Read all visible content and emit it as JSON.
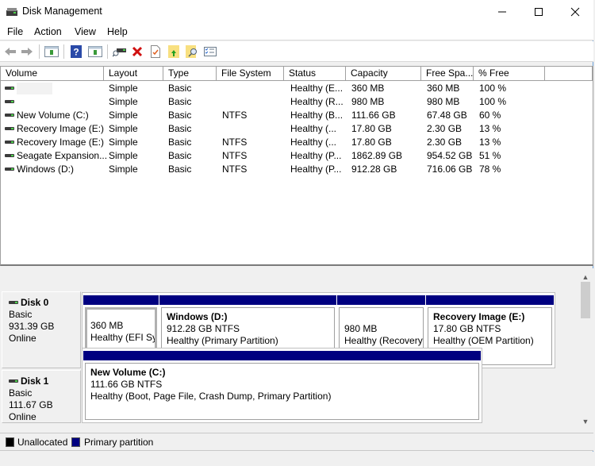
{
  "window": {
    "title": "Disk Management",
    "controls": {
      "minimize": "minimize",
      "maximize": "maximize",
      "close": "close"
    }
  },
  "menu": [
    "File",
    "Action",
    "View",
    "Help"
  ],
  "toolbar": {
    "buttons": [
      "back",
      "forward",
      "show-hide-console-tree",
      "help",
      "show-hide-action-pane",
      "connect-virtual-disk",
      "delete",
      "properties",
      "open",
      "explore",
      "settings"
    ]
  },
  "volume_list": {
    "columns": [
      "Volume",
      "Layout",
      "Type",
      "File System",
      "Status",
      "Capacity",
      "Free Spa...",
      "% Free"
    ],
    "rows": [
      {
        "volume": "",
        "layout": "Simple",
        "type": "Basic",
        "fs": "",
        "status": "Healthy (E...",
        "capacity": "360 MB",
        "free": "360 MB",
        "pct": "100 %"
      },
      {
        "volume": "",
        "layout": "Simple",
        "type": "Basic",
        "fs": "",
        "status": "Healthy (R...",
        "capacity": "980 MB",
        "free": "980 MB",
        "pct": "100 %"
      },
      {
        "volume": "New Volume (C:)",
        "layout": "Simple",
        "type": "Basic",
        "fs": "NTFS",
        "status": "Healthy (B...",
        "capacity": "111.66 GB",
        "free": "67.48 GB",
        "pct": "60 %"
      },
      {
        "volume": "Recovery Image (E:)",
        "layout": "Simple",
        "type": "Basic",
        "fs": "",
        "status": "Healthy (...",
        "capacity": "17.80 GB",
        "free": "2.30 GB",
        "pct": "13 %"
      },
      {
        "volume": "Recovery Image (E:)",
        "layout": "Simple",
        "type": "Basic",
        "fs": "NTFS",
        "status": "Healthy (...",
        "capacity": "17.80 GB",
        "free": "2.30 GB",
        "pct": "13 %"
      },
      {
        "volume": "Seagate Expansion...",
        "layout": "Simple",
        "type": "Basic",
        "fs": "NTFS",
        "status": "Healthy (P...",
        "capacity": "1862.89 GB",
        "free": "954.52 GB",
        "pct": "51 %"
      },
      {
        "volume": "Windows (D:)",
        "layout": "Simple",
        "type": "Basic",
        "fs": "NTFS",
        "status": "Healthy (P...",
        "capacity": "912.28 GB",
        "free": "716.06 GB",
        "pct": "78 %"
      }
    ]
  },
  "disks": [
    {
      "name": "Disk 0",
      "type": "Basic",
      "size": "931.39 GB",
      "state": "Online",
      "partitions": [
        {
          "name": "",
          "size": "360 MB",
          "status": "Healthy (EFI Sys",
          "selected": true
        },
        {
          "name": "Windows  (D:)",
          "size": "912.28 GB NTFS",
          "status": "Healthy (Primary Partition)"
        },
        {
          "name": "",
          "size": "980 MB",
          "status": "Healthy (Recovery"
        },
        {
          "name": "Recovery Image  (E:)",
          "size": "17.80 GB NTFS",
          "status": "Healthy (OEM Partition)"
        }
      ]
    },
    {
      "name": "Disk 1",
      "type": "Basic",
      "size": "111.67 GB",
      "state": "Online",
      "partitions": [
        {
          "name": "New Volume  (C:)",
          "size": "111.66 GB NTFS",
          "status": "Healthy (Boot, Page File, Crash Dump, Primary Partition)"
        }
      ]
    }
  ],
  "legend": [
    {
      "label": "Unallocated",
      "color": "#000000"
    },
    {
      "label": "Primary partition",
      "color": "#000080"
    }
  ],
  "colors": {
    "partition_bar": "#000080",
    "unallocated": "#000000"
  }
}
